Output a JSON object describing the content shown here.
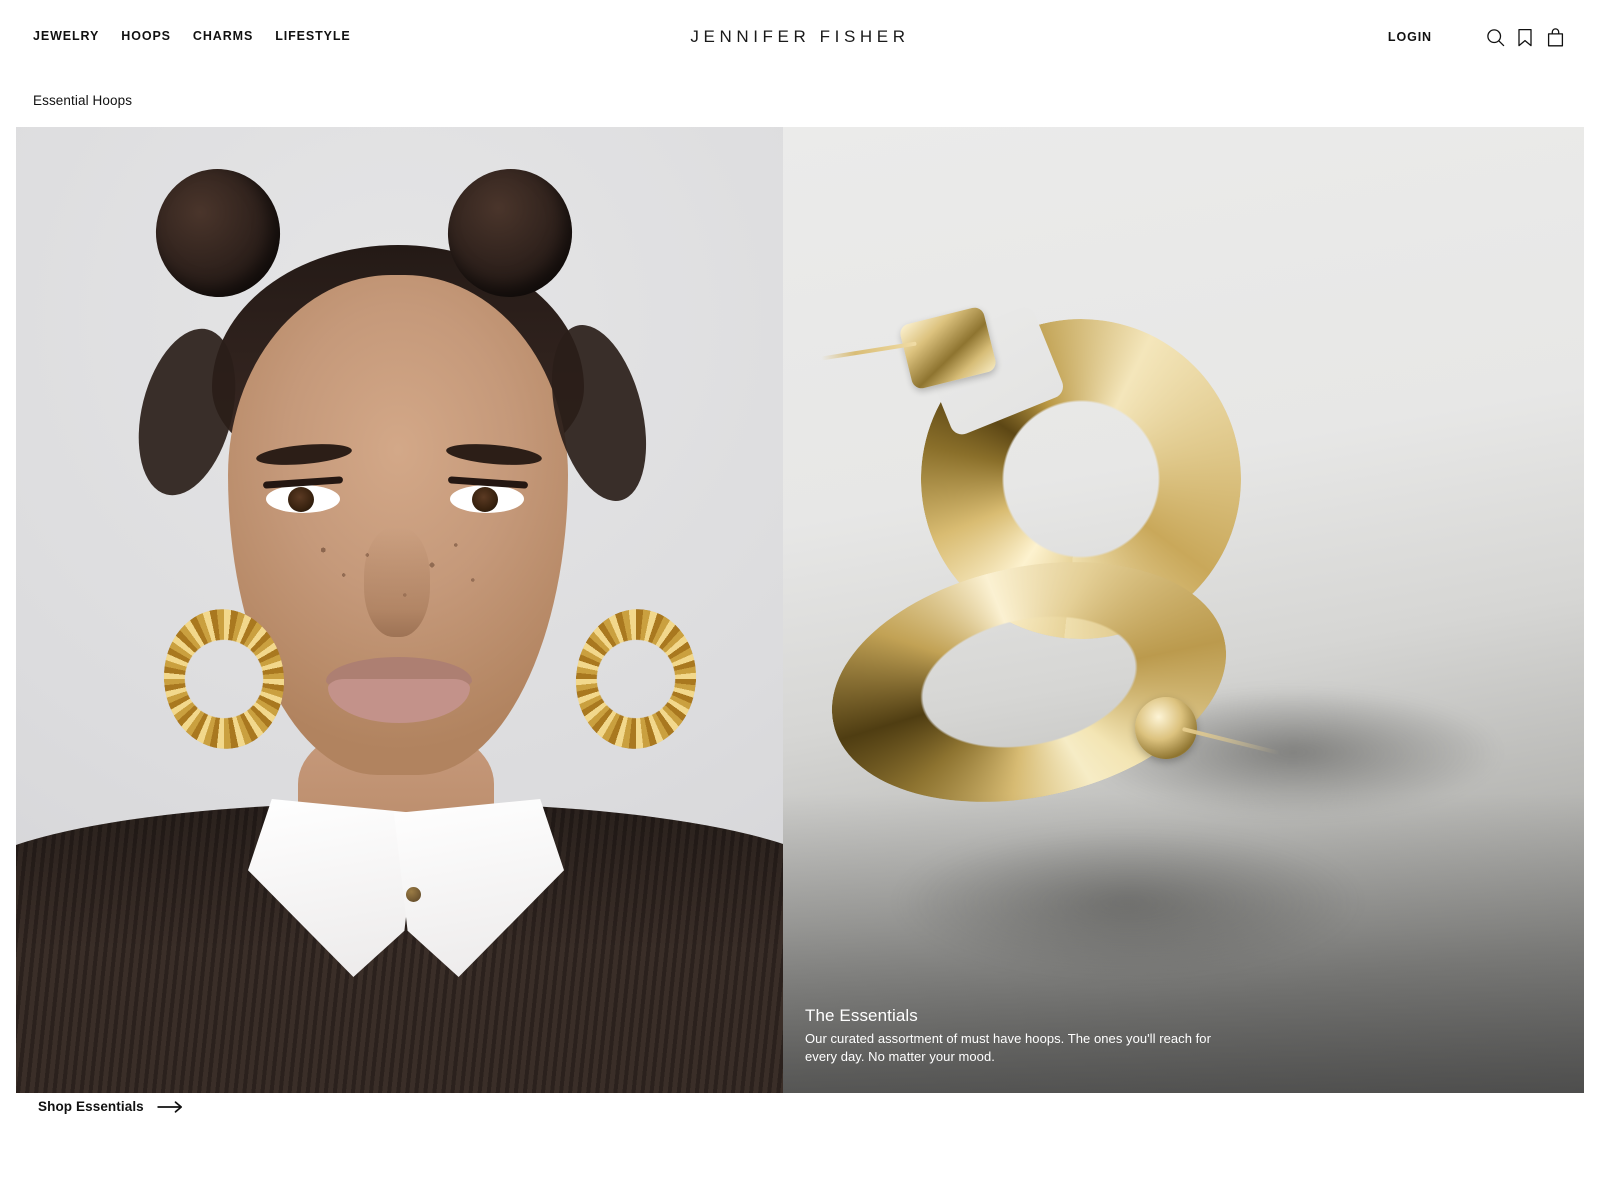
{
  "header": {
    "logo": "JENNIFER FISHER",
    "nav": [
      {
        "label": "JEWELRY"
      },
      {
        "label": "HOOPS"
      },
      {
        "label": "CHARMS"
      },
      {
        "label": "LIFESTYLE"
      }
    ],
    "login_label": "LOGIN",
    "icons": [
      {
        "name": "search-icon"
      },
      {
        "name": "bookmark-icon"
      },
      {
        "name": "shopping-bag-icon"
      }
    ]
  },
  "breadcrumb": {
    "label": "Essential Hoops"
  },
  "hero": {
    "left_image": {
      "alt": "Model wearing textured gold hoop earrings with space buns, white collar shirt and dark brown ribbed sweater"
    },
    "right_image": {
      "alt": "Two thick polished gold hoop earrings on a light to gray gradient surface",
      "title": "The Essentials",
      "description": "Our curated assortment of must have hoops. The ones you'll reach for every day. No matter your mood."
    }
  },
  "cta": {
    "label": "Shop Essentials",
    "arrow": "arrow-right-icon"
  },
  "colors": {
    "page_background": "#ffffff",
    "text_primary": "#111111",
    "overlay_text": "#ffffff",
    "gold": "#d4b263"
  }
}
